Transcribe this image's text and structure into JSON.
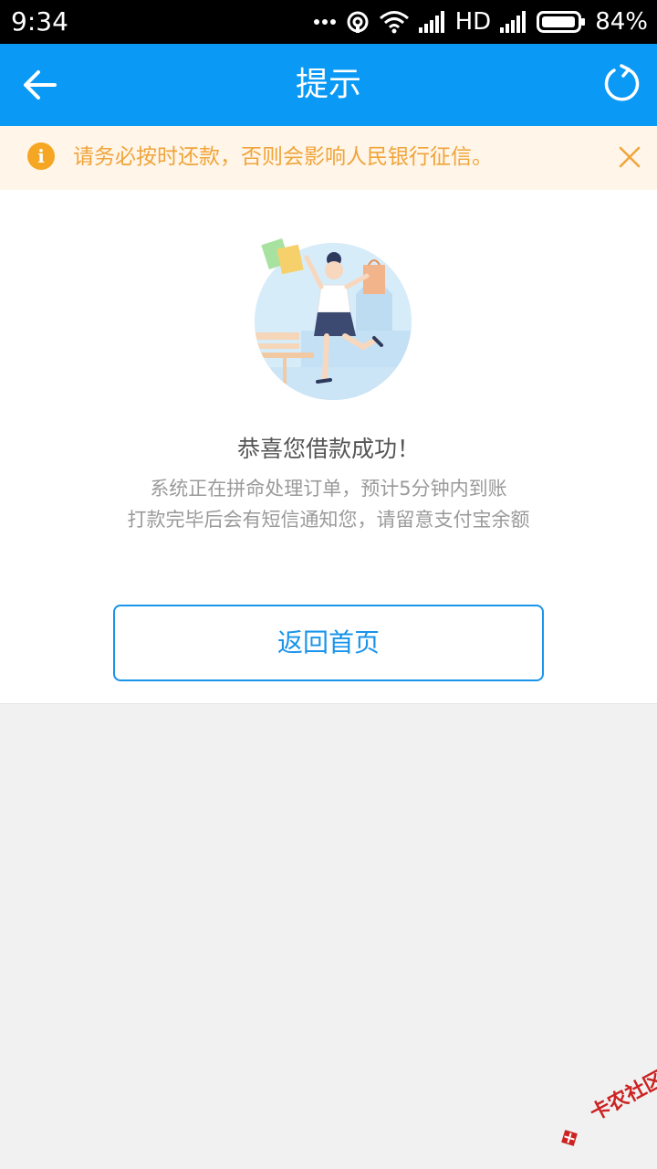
{
  "status_bar": {
    "time": "9:34",
    "network": "HD",
    "battery": "84%",
    "icons": [
      "more-dots-icon",
      "hotspot-icon",
      "wifi-icon",
      "signal-icon",
      "signal-icon",
      "battery-icon"
    ]
  },
  "app_bar": {
    "title": "提示",
    "back_icon": "arrow-left-icon",
    "refresh_icon": "refresh-icon",
    "color": "#0a99f5"
  },
  "notice": {
    "text": "请务必按时还款，否则会影响人民银行征信。",
    "icon_glyph": "i",
    "icon": "info-icon",
    "close_icon": "close-icon",
    "color": "#f0a43a",
    "background": "#fff5e8"
  },
  "main": {
    "title": "恭喜您借款成功！",
    "description_line1": "系统正在拼命处理订单，预计5分钟内到账",
    "description_line2": "打款完毕后会有短信通知您，请留意支付宝余额",
    "home_button_label": "返回首页"
  },
  "watermark": {
    "text": "卡农社区"
  }
}
